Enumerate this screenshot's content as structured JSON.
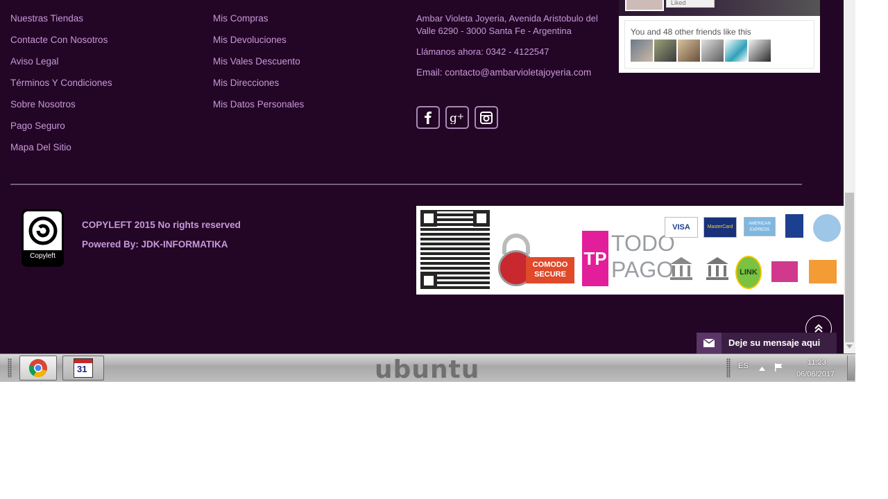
{
  "footer": {
    "info_links": [
      "Nuestras Tiendas",
      "Contacte Con Nosotros",
      "Aviso Legal",
      "Términos Y Condiciones",
      "Sobre Nosotros",
      "Pago Seguro",
      "Mapa Del Sitio"
    ],
    "account_links": [
      "Mis Compras",
      "Mis Devoluciones",
      "Mis Vales Descuento",
      "Mis Direcciones",
      "Mis Datos Personales"
    ],
    "contact": {
      "address_line1": "Ambar Violeta Joyeria, Avenida Aristobulo del",
      "address_line2": "Valle 6290 - 3000 Santa Fe - Argentina",
      "phone": "Llámanos ahora: 0342 - 4122547",
      "email": "Email: contacto@ambarvioletajoyeria.com"
    },
    "social": [
      "facebook-icon",
      "google-plus-icon",
      "instagram-icon"
    ],
    "facebook_widget": {
      "liked_label": "Liked",
      "friends_text": "You and 48 other friends like this",
      "friend_count_shown": 6
    },
    "copyright": {
      "logo_label": "Copyleft",
      "line1": "COPYLEFT 2015 No rights reserved",
      "line2": "Powered By: JDK-INFORMATIKA"
    },
    "payments": {
      "secure_label": "COMODO SECURE",
      "todo_pago_line1": "TODO",
      "todo_pago_line2": "PAGO",
      "cards": [
        "VISA",
        "MasterCard",
        "AMERICAN EXPRESS"
      ],
      "link_label": "LINK"
    },
    "message_widget": {
      "label": "Deje su mensaje aqui"
    }
  },
  "taskbar": {
    "brand": "ubuntu",
    "keyboard_layout": "ES",
    "time": "11:23",
    "date": "06/06/2017",
    "calendar_day": "31"
  },
  "colors": {
    "page_bg": "#230526",
    "link": "#c79ad8",
    "accent": "#5a3566"
  }
}
